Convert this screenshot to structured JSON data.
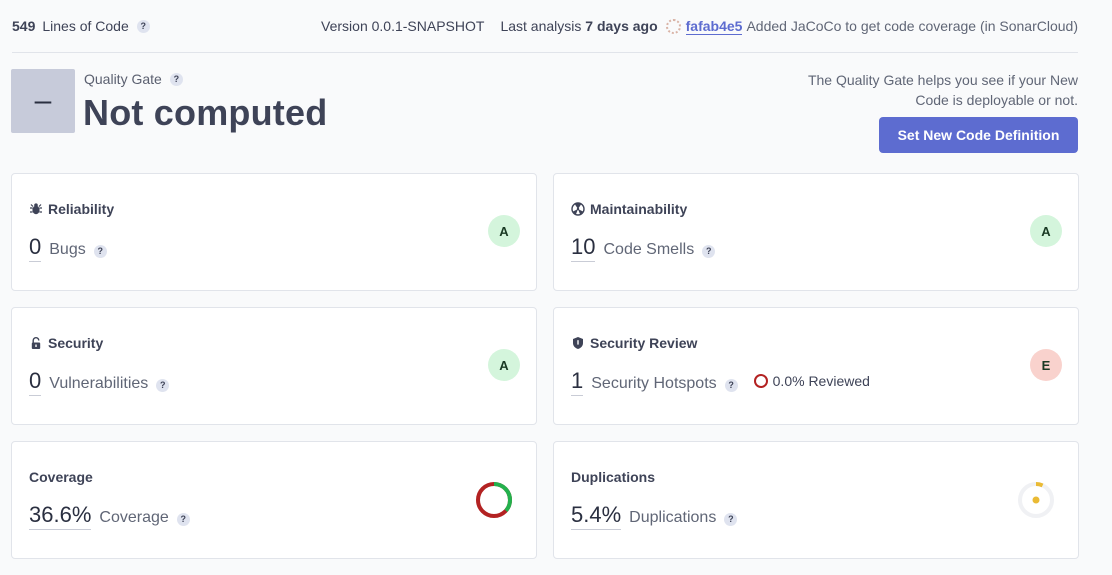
{
  "topbar": {
    "lines_of_code_value": "549",
    "lines_of_code_label": "Lines of Code",
    "version": "Version 0.0.1-SNAPSHOT",
    "last_analysis_prefix": "Last analysis",
    "last_analysis_value": "7 days ago",
    "commit_hash": "fafab4e5",
    "commit_message": "Added JaCoCo to get code coverage (in SonarCloud)"
  },
  "quality_gate": {
    "symbol": "–",
    "label": "Quality Gate",
    "status": "Not computed",
    "hint": "The Quality Gate helps you see if your New Code is deployable or not.",
    "button_label": "Set New Code Definition"
  },
  "help_symbol": "?",
  "cards": {
    "reliability": {
      "title": "Reliability",
      "value": "0",
      "label": "Bugs",
      "rating": "A",
      "rating_color": "#d4f5dc"
    },
    "maintainability": {
      "title": "Maintainability",
      "value": "10",
      "label": "Code Smells",
      "rating": "A",
      "rating_color": "#d4f5dc"
    },
    "security": {
      "title": "Security",
      "value": "0",
      "label": "Vulnerabilities",
      "rating": "A",
      "rating_color": "#d4f5dc"
    },
    "security_review": {
      "title": "Security Review",
      "value": "1",
      "label": "Security Hotspots",
      "reviewed": "0.0% Reviewed",
      "rating": "E",
      "rating_color": "#f9d2cd"
    },
    "coverage": {
      "title": "Coverage",
      "value": "36.6%",
      "label": "Coverage",
      "percent": 36.6,
      "covered_color": "#23b14d",
      "uncovered_color": "#b32222"
    },
    "duplications": {
      "title": "Duplications",
      "value": "5.4%",
      "label": "Duplications",
      "percent": 5.4,
      "accent": "#eaba34"
    }
  },
  "icons": {
    "reliability": "bug-icon",
    "maintainability": "radiation-icon",
    "security": "lock-icon",
    "security_review": "shield-icon",
    "help": "help-icon"
  }
}
